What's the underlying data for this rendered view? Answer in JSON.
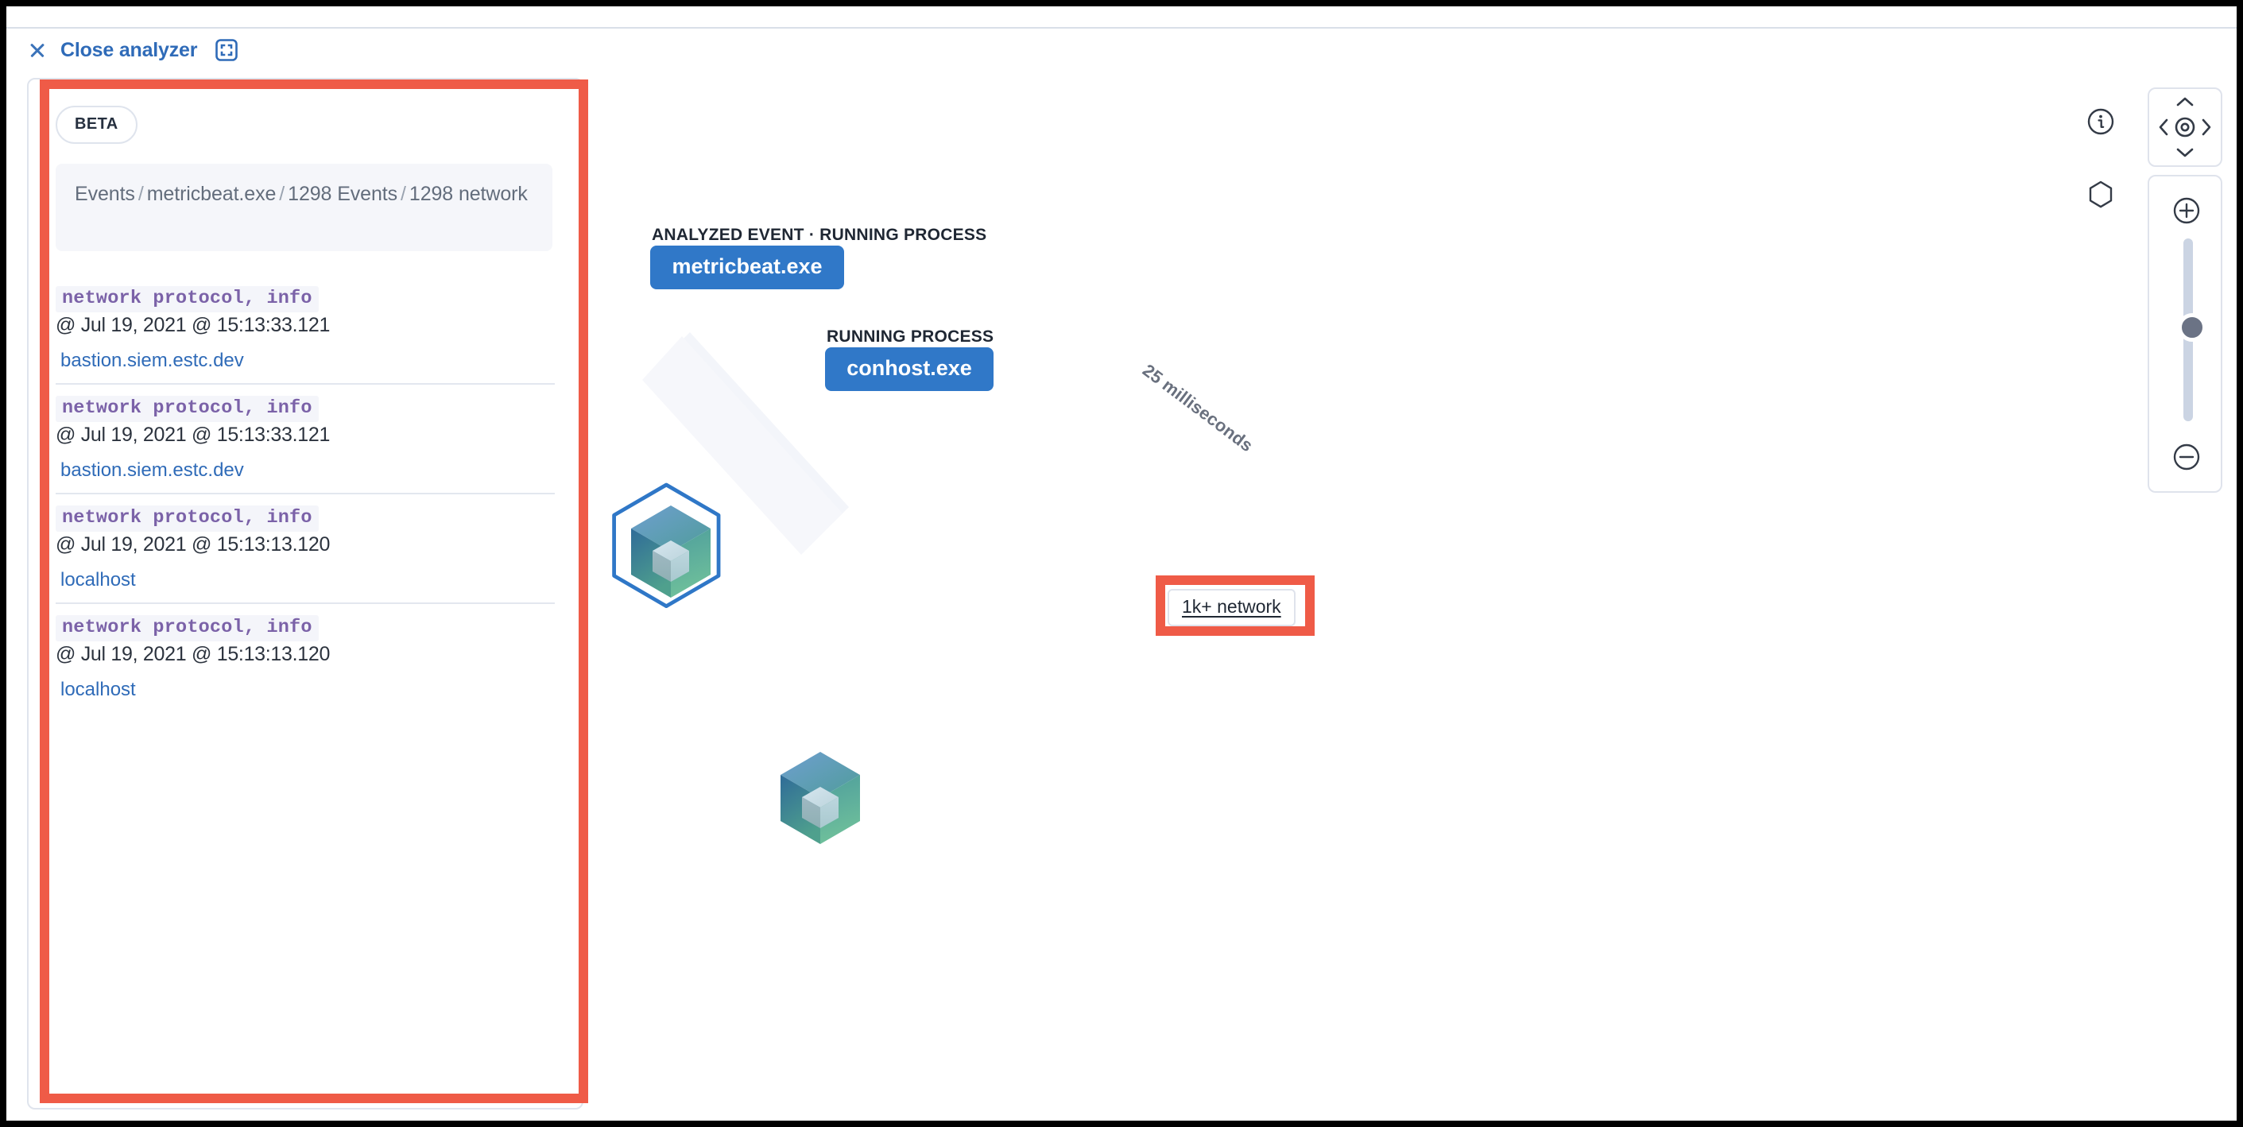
{
  "header": {
    "close_label": "Close analyzer",
    "close_icon": "close-x-icon",
    "fullscreen_icon": "fullscreen-icon"
  },
  "events_panel": {
    "beta_badge": "BETA",
    "breadcrumb": {
      "parts": [
        "Events",
        "metricbeat.exe",
        "1298 Events",
        "1298 network"
      ],
      "separator": "/"
    },
    "items": [
      {
        "kind": "network protocol, info",
        "time": "@ Jul 19, 2021 @ 15:13:33.121",
        "host": "bastion.siem.estc.dev"
      },
      {
        "kind": "network protocol, info",
        "time": "@ Jul 19, 2021 @ 15:13:33.121",
        "host": "bastion.siem.estc.dev"
      },
      {
        "kind": "network protocol, info",
        "time": "@ Jul 19, 2021 @ 15:13:13.120",
        "host": "localhost"
      },
      {
        "kind": "network protocol, info",
        "time": "@ Jul 19, 2021 @ 15:13:13.120",
        "host": "localhost"
      }
    ]
  },
  "graph": {
    "nodes": [
      {
        "title": "ANALYZED EVENT · RUNNING PROCESS",
        "label": "metricbeat.exe",
        "analyzed": true
      },
      {
        "title": "RUNNING PROCESS",
        "label": "conhost.exe",
        "analyzed": false
      }
    ],
    "related_pill": "1k+ network",
    "edge_label": "25 milliseconds"
  },
  "controls": {
    "info_icon": "info-circle-icon",
    "legend_icon": "hexagon-legend-icon",
    "pan": {
      "up_icon": "chevron-up-icon",
      "down_icon": "chevron-down-icon",
      "left_icon": "chevron-left-icon",
      "right_icon": "chevron-right-icon",
      "center_icon": "center-target-icon"
    },
    "zoom": {
      "in_icon": "zoom-in-plus-icon",
      "out_icon": "zoom-out-minus-icon"
    }
  },
  "colors": {
    "accent_blue": "#3078c8",
    "link_blue": "#2f6bb8",
    "annotation_red": "#ef5b47",
    "kind_purple": "#7b62a8"
  }
}
